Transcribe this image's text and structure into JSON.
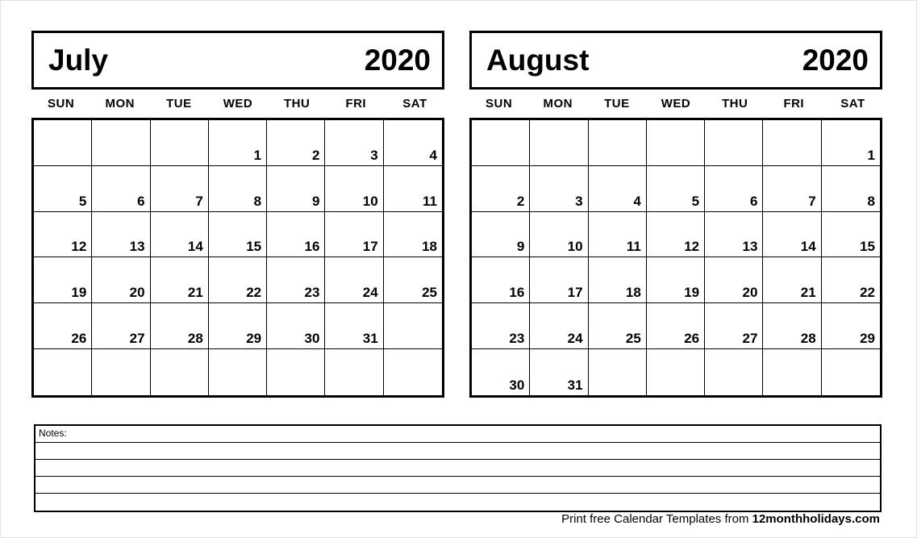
{
  "page": {
    "background_color": "#ffffff",
    "border_color": "#e3e3e3",
    "ink_color": "#000000"
  },
  "weekday_headers": [
    "SUN",
    "MON",
    "TUE",
    "WED",
    "THU",
    "FRI",
    "SAT"
  ],
  "months": [
    {
      "name": "July",
      "year": "2020",
      "weeks": [
        [
          "",
          "",
          "",
          "1",
          "2",
          "3",
          "4"
        ],
        [
          "5",
          "6",
          "7",
          "8",
          "9",
          "10",
          "11"
        ],
        [
          "12",
          "13",
          "14",
          "15",
          "16",
          "17",
          "18"
        ],
        [
          "19",
          "20",
          "21",
          "22",
          "23",
          "24",
          "25"
        ],
        [
          "26",
          "27",
          "28",
          "29",
          "30",
          "31",
          ""
        ],
        [
          "",
          "",
          "",
          "",
          "",
          "",
          ""
        ]
      ]
    },
    {
      "name": "August",
      "year": "2020",
      "weeks": [
        [
          "",
          "",
          "",
          "",
          "",
          "",
          "1"
        ],
        [
          "2",
          "3",
          "4",
          "5",
          "6",
          "7",
          "8"
        ],
        [
          "9",
          "10",
          "11",
          "12",
          "13",
          "14",
          "15"
        ],
        [
          "16",
          "17",
          "18",
          "19",
          "20",
          "21",
          "22"
        ],
        [
          "23",
          "24",
          "25",
          "26",
          "27",
          "28",
          "29"
        ],
        [
          "30",
          "31",
          "",
          "",
          "",
          "",
          ""
        ]
      ]
    }
  ],
  "notes": {
    "label": "Notes:",
    "blank_line_count": 4
  },
  "footer": {
    "text": "Print free Calendar Templates from",
    "site": "12monthholidays.com"
  }
}
